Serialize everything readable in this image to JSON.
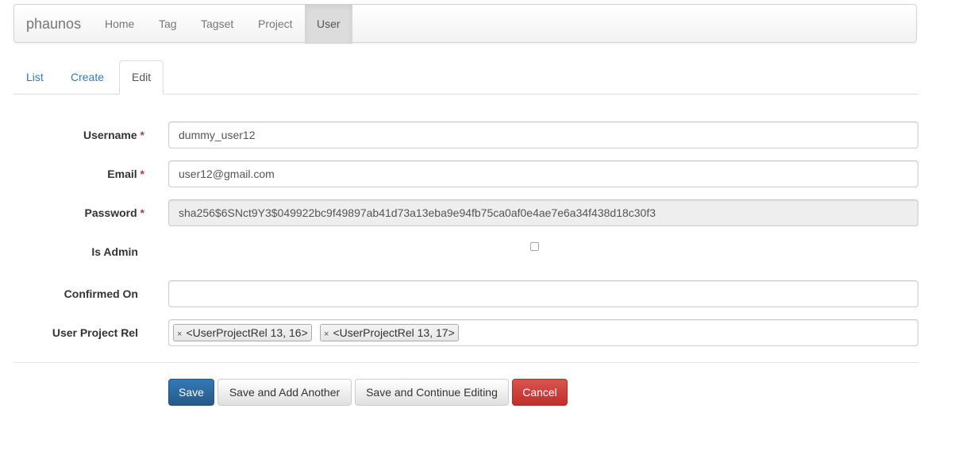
{
  "navbar": {
    "brand": "phaunos",
    "items": [
      {
        "label": "Home"
      },
      {
        "label": "Tag"
      },
      {
        "label": "Tagset"
      },
      {
        "label": "Project"
      },
      {
        "label": "User"
      }
    ],
    "active_item": "User"
  },
  "tabs": {
    "items": [
      {
        "label": "List"
      },
      {
        "label": "Create"
      },
      {
        "label": "Edit"
      }
    ],
    "active_tab": "Edit"
  },
  "form": {
    "username": {
      "label": "Username",
      "required_marker": "*",
      "value": "dummy_user12"
    },
    "email": {
      "label": "Email",
      "required_marker": "*",
      "value": "user12@gmail.com"
    },
    "password": {
      "label": "Password",
      "required_marker": "*",
      "value": "sha256$6SNct9Y3$049922bc9f49897ab41d73a13eba9e94fb75ca0af0e4ae7e6a34f438d18c30f3"
    },
    "is_admin": {
      "label": "Is Admin",
      "checked": false
    },
    "confirmed_on": {
      "label": "Confirmed On",
      "value": ""
    },
    "user_project_rel": {
      "label": "User Project Rel",
      "remove_symbol": "×",
      "selected": [
        {
          "label": "<UserProjectRel 13, 16>"
        },
        {
          "label": "<UserProjectRel 13, 17>"
        }
      ]
    }
  },
  "actions": {
    "save": "Save",
    "save_and_add": "Save and Add Another",
    "save_and_continue": "Save and Continue Editing",
    "cancel": "Cancel"
  },
  "colors": {
    "primary": "#337ab7",
    "danger": "#d9534f",
    "required": "#a94442"
  }
}
